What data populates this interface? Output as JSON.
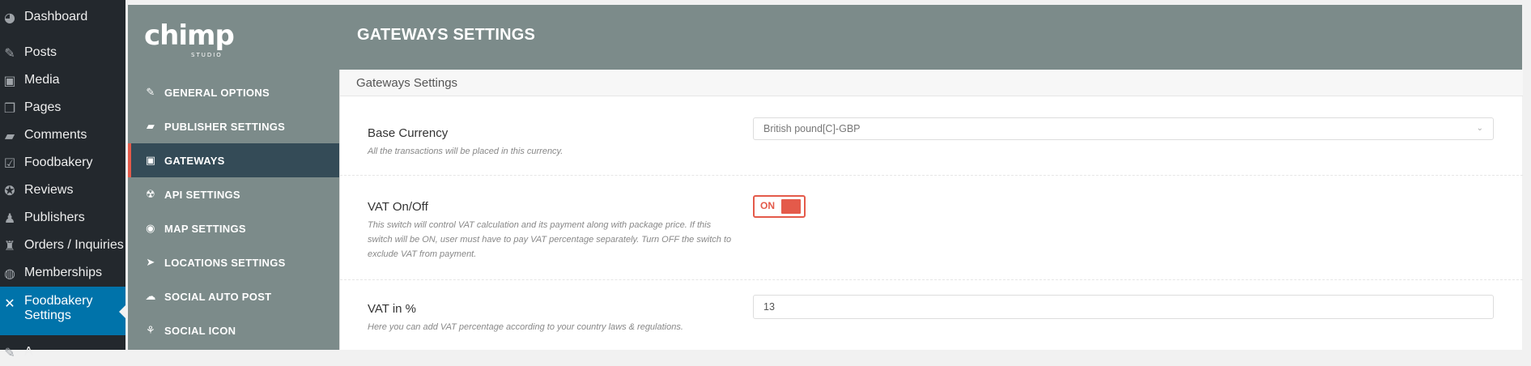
{
  "wp_menu": {
    "items": [
      {
        "label": "Dashboard",
        "icon": "dashboard-icon",
        "glyph": "◕"
      },
      {
        "label": "Posts",
        "icon": "pin-icon",
        "glyph": "✎"
      },
      {
        "label": "Media",
        "icon": "media-icon",
        "glyph": "▣"
      },
      {
        "label": "Pages",
        "icon": "pages-icon",
        "glyph": "❐"
      },
      {
        "label": "Comments",
        "icon": "comments-icon",
        "glyph": "▰"
      },
      {
        "label": "Foodbakery",
        "icon": "checkbox-icon",
        "glyph": "☑"
      },
      {
        "label": "Reviews",
        "icon": "star-icon",
        "glyph": "✪"
      },
      {
        "label": "Publishers",
        "icon": "user-icon",
        "glyph": "♟"
      },
      {
        "label": "Orders / Inquiries",
        "icon": "cart-icon",
        "glyph": "♜"
      },
      {
        "label": "Memberships",
        "icon": "membership-icon",
        "glyph": "◍"
      },
      {
        "label": "Foodbakery Settings",
        "icon": "tools-icon",
        "glyph": "✕"
      },
      {
        "label": "A",
        "icon": "appearance-icon",
        "glyph": "✎"
      }
    ],
    "active_index": 10
  },
  "header": {
    "logo_text": "chimp",
    "logo_sub": "STUDIO",
    "title": "GATEWAYS SETTINGS"
  },
  "plugin_nav": {
    "items": [
      {
        "label": "GENERAL OPTIONS",
        "icon": "wrench-icon",
        "glyph": "✎"
      },
      {
        "label": "PUBLISHER SETTINGS",
        "icon": "book-icon",
        "glyph": "▰"
      },
      {
        "label": "GATEWAYS",
        "icon": "wallet-icon",
        "glyph": "▣"
      },
      {
        "label": "API SETTINGS",
        "icon": "api-icon",
        "glyph": "☢"
      },
      {
        "label": "MAP SETTINGS",
        "icon": "map-pin-icon",
        "glyph": "◉"
      },
      {
        "label": "LOCATIONS SETTINGS",
        "icon": "location-arrow-icon",
        "glyph": "➤"
      },
      {
        "label": "SOCIAL AUTO POST",
        "icon": "chat-icon",
        "glyph": "☁"
      },
      {
        "label": "SOCIAL ICON",
        "icon": "share-icon",
        "glyph": "⚘"
      }
    ],
    "active_index": 2
  },
  "main": {
    "section_title": "Gateways Settings",
    "fields": {
      "base_currency": {
        "label": "Base Currency",
        "desc": "All the transactions will be placed in this currency.",
        "value": "British pound[C]-GBP"
      },
      "vat_toggle": {
        "label": "VAT On/Off",
        "desc": "This switch will control VAT calculation and its payment along with package price. If this switch will be ON, user must have to pay VAT percentage separately. Turn OFF the switch to exclude VAT from payment.",
        "state": "ON"
      },
      "vat_percent": {
        "label": "VAT in %",
        "desc": "Here you can add VAT percentage according to your country laws & regulations.",
        "value": "13"
      }
    }
  },
  "colors": {
    "wp_sidebar": "#23282d",
    "wp_active": "#0073aa",
    "plugin_header": "#7c8b8a",
    "plugin_nav_active": "#344b57",
    "accent": "#e45a4a"
  }
}
